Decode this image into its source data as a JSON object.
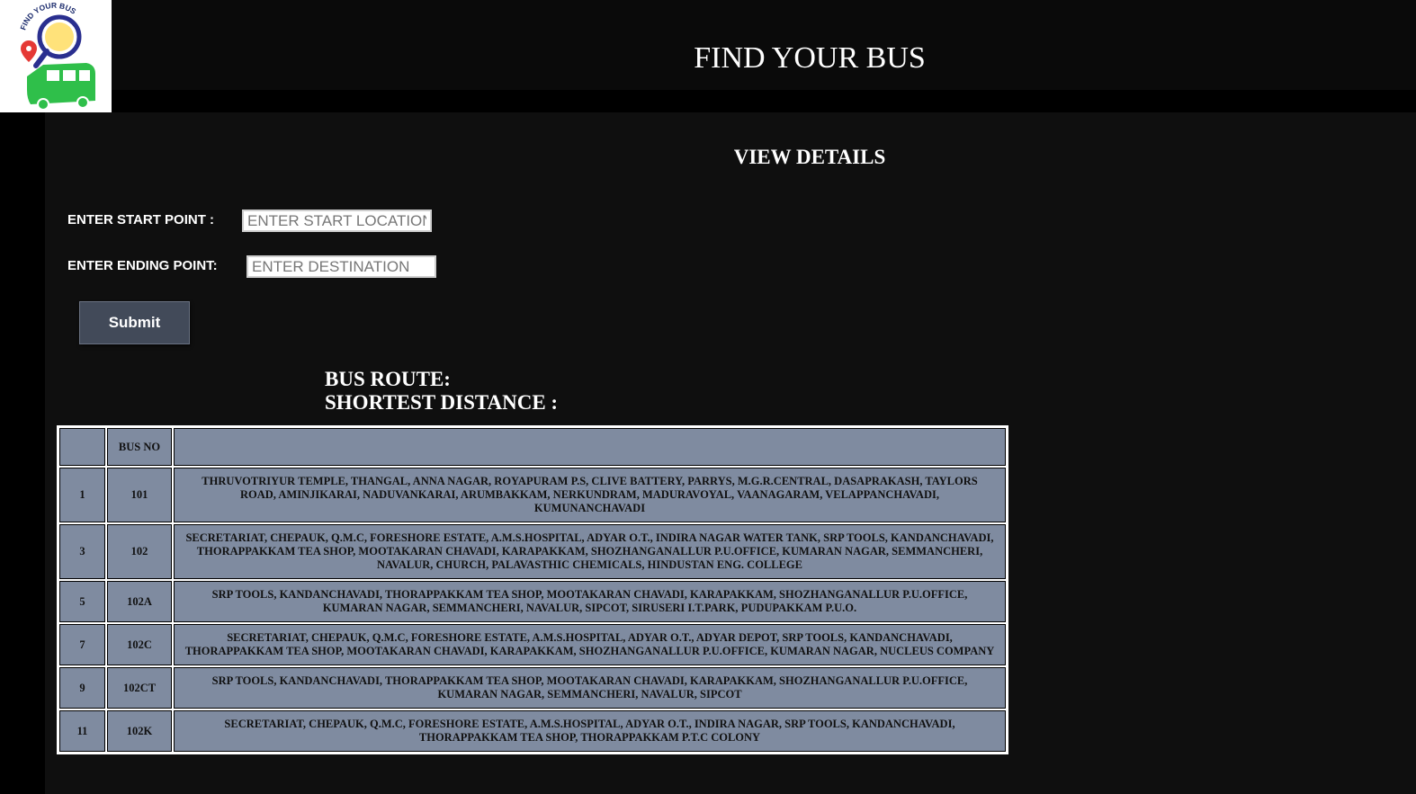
{
  "header": {
    "title": "FIND YOUR BUS",
    "logo_text": "FIND YOUR BUS"
  },
  "main": {
    "heading": "VIEW DETAILS",
    "start": {
      "label": "ENTER START POINT :",
      "placeholder": "ENTER START LOCATION",
      "value": ""
    },
    "end": {
      "label": "ENTER ENDING POINT:",
      "placeholder": "ENTER DESTINATION",
      "value": ""
    },
    "submit_label": "Submit",
    "bus_route_label": "BUS ROUTE:",
    "shortest_distance_label": "SHORTEST DISTANCE :"
  },
  "table": {
    "headers": [
      "",
      "BUS NO",
      ""
    ],
    "rows": [
      {
        "idx": "1",
        "bus": "101",
        "route": "THRUVOTRIYUR TEMPLE, THANGAL, ANNA NAGAR, ROYAPURAM P.S, CLIVE BATTERY, PARRYS, M.G.R.CENTRAL, DASAPRAKASH, TAYLORS ROAD, AMINJIKARAI, NADUVANKARAI, ARUMBAKKAM, NERKUNDRAM, MADURAVOYAL, VAANAGARAM, VELAPPANCHAVADI, KUMUNANCHAVADI"
      },
      {
        "idx": "3",
        "bus": "102",
        "route": "SECRETARIAT, CHEPAUK, Q.M.C, FORESHORE ESTATE, A.M.S.HOSPITAL, ADYAR O.T., INDIRA NAGAR WATER TANK, SRP TOOLS, KANDANCHAVADI, THORAPPAKKAM TEA SHOP, MOOTAKARAN CHAVADI, KARAPAKKAM, SHOZHANGANALLUR P.U.OFFICE, KUMARAN NAGAR, SEMMANCHERI, NAVALUR, CHURCH, PALAVASTHIC CHEMICALS, HINDUSTAN ENG. COLLEGE"
      },
      {
        "idx": "5",
        "bus": "102A",
        "route": "SRP TOOLS, KANDANCHAVADI, THORAPPAKKAM TEA SHOP, MOOTAKARAN CHAVADI, KARAPAKKAM, SHOZHANGANALLUR P.U.OFFICE, KUMARAN NAGAR, SEMMANCHERI, NAVALUR, SIPCOT, SIRUSERI I.T.PARK, PUDUPAKKAM P.U.O."
      },
      {
        "idx": "7",
        "bus": "102C",
        "route": "SECRETARIAT, CHEPAUK, Q.M.C, FORESHORE ESTATE, A.M.S.HOSPITAL, ADYAR O.T., ADYAR DEPOT, SRP TOOLS, KANDANCHAVADI, THORAPPAKKAM TEA SHOP, MOOTAKARAN CHAVADI, KARAPAKKAM, SHOZHANGANALLUR P.U.OFFICE, KUMARAN NAGAR, NUCLEUS COMPANY"
      },
      {
        "idx": "9",
        "bus": "102CT",
        "route": "SRP TOOLS, KANDANCHAVADI, THORAPPAKKAM TEA SHOP, MOOTAKARAN CHAVADI, KARAPAKKAM, SHOZHANGANALLUR P.U.OFFICE, KUMARAN NAGAR, SEMMANCHERI, NAVALUR, SIPCOT"
      },
      {
        "idx": "11",
        "bus": "102K",
        "route": "SECRETARIAT, CHEPAUK, Q.M.C, FORESHORE ESTATE, A.M.S.HOSPITAL, ADYAR O.T., INDIRA NAGAR, SRP TOOLS, KANDANCHAVADI, THORAPPAKKAM TEA SHOP, THORAPPAKKAM P.T.C COLONY"
      }
    ]
  },
  "colors": {
    "page_bg": "#000000",
    "panel_bg": "#0f0f0f",
    "table_cell_bg": "#7f8ba0",
    "button_bg": "#424a59"
  }
}
